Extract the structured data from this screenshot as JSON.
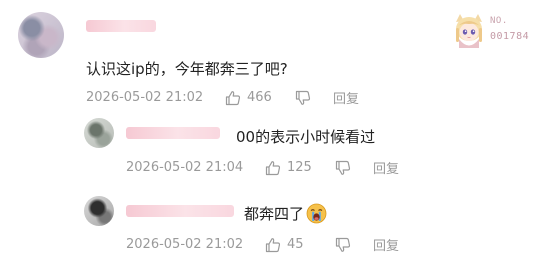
{
  "badge": {
    "label": "NO.",
    "number": "001784"
  },
  "comments": [
    {
      "text": "认识这ip的，今年都奔三了吧?",
      "time": "2026-05-02 21:02",
      "likes": "466",
      "reply_label": "回复"
    },
    {
      "text": "00的表示小时候看过",
      "time": "2026-05-02 21:04",
      "likes": "125",
      "reply_label": "回复"
    },
    {
      "text": "都奔四了",
      "emoji": "crying-face-emoji",
      "time": "2026-05-02 21:02",
      "likes": "45",
      "reply_label": "回复"
    }
  ]
}
